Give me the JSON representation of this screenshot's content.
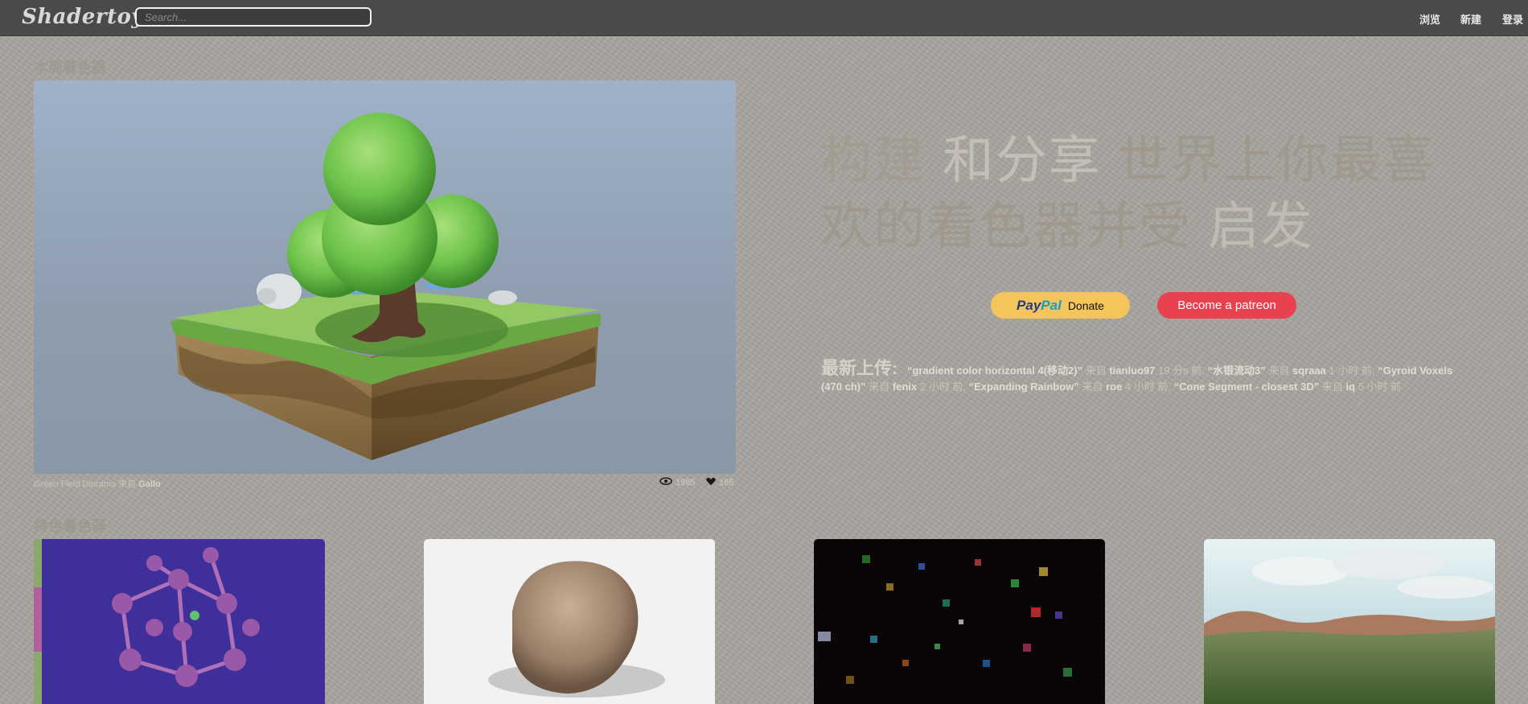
{
  "app": {
    "logo": "Shadertoy",
    "search_placeholder": "Search...",
    "nav": {
      "browse": "浏览",
      "new": "新建",
      "login": "登录"
    }
  },
  "weekly": {
    "title": "本周着色器",
    "shader_name": "Green Field Diorama",
    "from": "来自",
    "author": "Gallo",
    "views": "1985",
    "likes": "165"
  },
  "hero_text": {
    "part1": "构建 ",
    "part2": "和分享 ",
    "part3": "世界上你最喜欢的着色器并受 ",
    "part4": "启发"
  },
  "buttons": {
    "paypal_brand_1": "Pay",
    "paypal_brand_2": "Pal",
    "donate": "Donate",
    "patreon": "Become a patreon"
  },
  "latest": {
    "label": "最新上传:",
    "from": "来自",
    "items": [
      {
        "title": "“gradient color horizontal 4(移动2)”",
        "user": "tianluo97",
        "time": "19 分s 前,"
      },
      {
        "title": "“水银流动3”",
        "user": "sqraaa",
        "time": "1 小时 前,"
      },
      {
        "title": "“Gyroid Voxels (470 ch)”",
        "user": "fenix",
        "time": "2 小时 前,"
      },
      {
        "title": "“Expanding Rainbow”",
        "user": "roe",
        "time": "4 小时 前,"
      },
      {
        "title": "“Cone Segment - closest 3D”",
        "user": "iq",
        "time": "5 小时 前"
      }
    ]
  },
  "featured": {
    "title": "特色着色器"
  },
  "colors": {
    "topbar": "#4a4a4a",
    "background": "#a9a5a0",
    "paypal": "#f3c55a",
    "patreon": "#e8414f"
  }
}
